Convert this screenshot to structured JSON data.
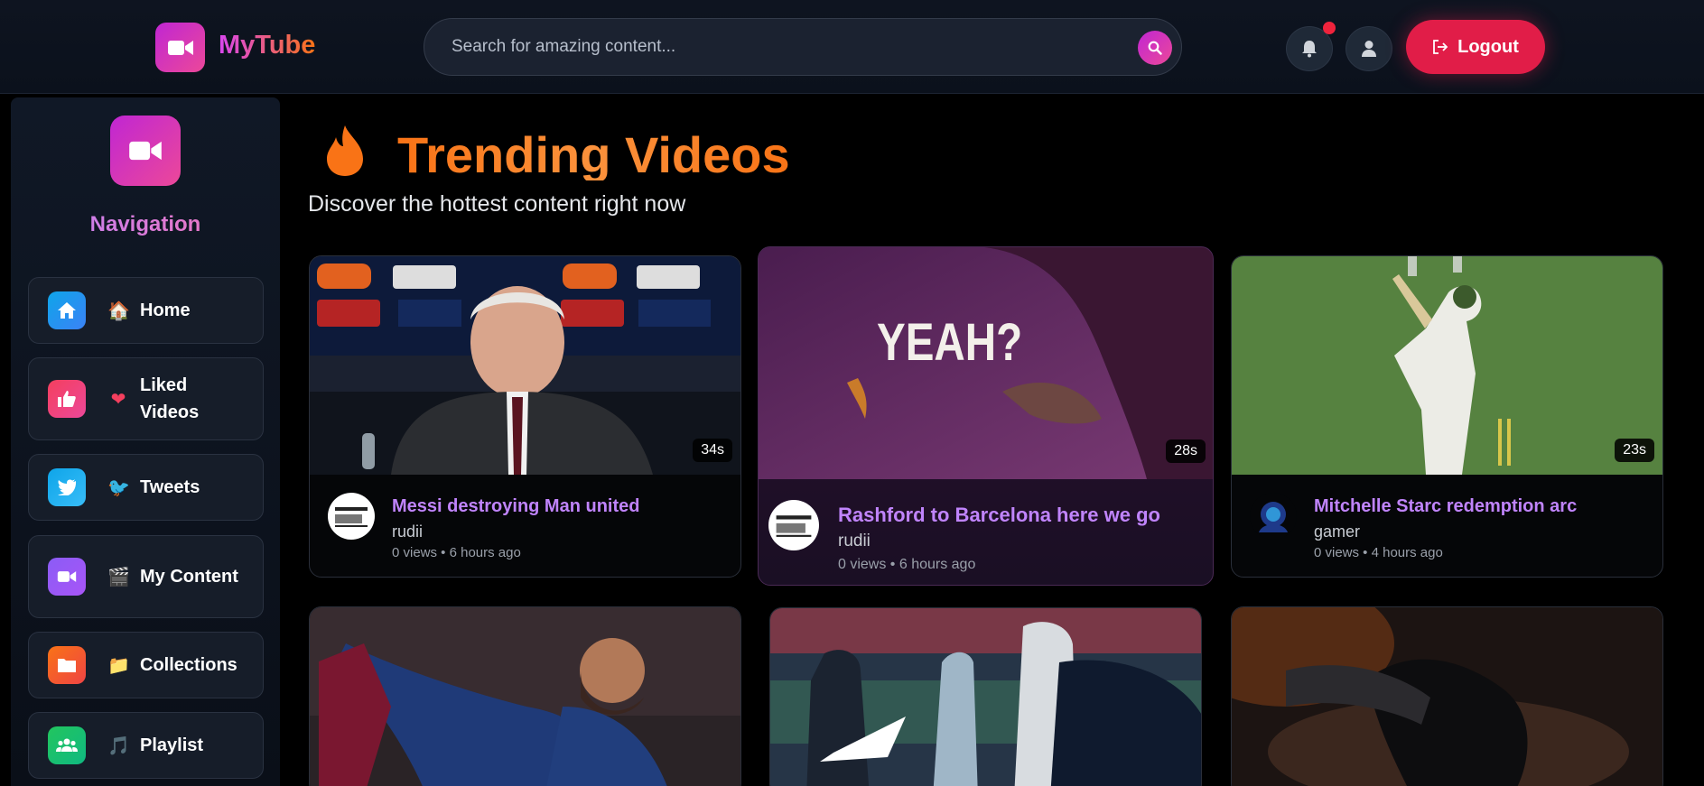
{
  "header": {
    "app_name": "MyTube",
    "search_placeholder": "Search for amazing content...",
    "logout_label": "Logout"
  },
  "sidebar": {
    "title": "Navigation",
    "items": [
      {
        "label": "Home",
        "emoji": "🏠",
        "icon": "home-icon",
        "color": "#0ea5e9"
      },
      {
        "label": "Liked Videos",
        "emoji": "❤",
        "icon": "thumbs-up-icon",
        "color": "#f43f5e"
      },
      {
        "label": "Tweets",
        "emoji": "🐦",
        "icon": "twitter-icon",
        "color": "#0ea5e9"
      },
      {
        "label": "My Content",
        "emoji": "🎬",
        "icon": "video-camera-icon",
        "color": "#8b5cf6"
      },
      {
        "label": "Collections",
        "emoji": "📁",
        "icon": "folder-icon",
        "color": "#f97316"
      },
      {
        "label": "Playlist",
        "emoji": "🎵",
        "icon": "users-icon",
        "color": "#22c55e"
      }
    ]
  },
  "main": {
    "title": "Trending Videos",
    "subtitle": "Discover the hottest content right now"
  },
  "videos": [
    {
      "title": "Messi destroying Man united",
      "channel": "rudii",
      "meta": "0 views • 6 hours ago",
      "duration": "34s"
    },
    {
      "title": "Rashford to Barcelona here we go",
      "channel": "rudii",
      "meta": "0 views • 6 hours ago",
      "duration": "28s",
      "overlay_text": "YEAH?"
    },
    {
      "title": "Mitchelle Starc redemption arc",
      "channel": "gamer",
      "meta": "0 views • 4 hours ago",
      "duration": "23s"
    }
  ],
  "colors": {
    "accent": "#d946ef",
    "title_orange": "#f97316",
    "logout": "#e11d48",
    "video_title": "#c084fc"
  }
}
